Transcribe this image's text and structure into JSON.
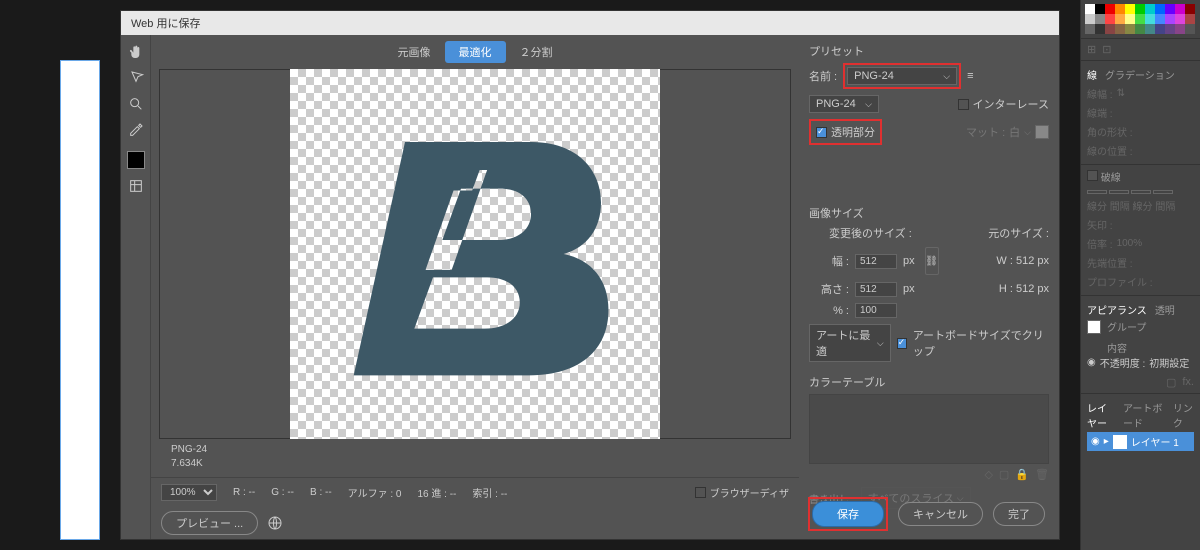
{
  "dialog": {
    "title": "Web 用に保存",
    "tabs": {
      "orig": "元画像",
      "optimized": "最適化",
      "split": "２分割"
    },
    "preview": {
      "format": "PNG-24",
      "size": "7.634K"
    },
    "bottom": {
      "zoom": "100%",
      "r": "R : --",
      "g": "G : --",
      "b": "B : --",
      "alpha": "アルファ : 0",
      "hex": "16 進 : --",
      "index": "索引 : --",
      "browser_dither": "ブラウザーディザ"
    },
    "preview_btn": "プレビュー ..."
  },
  "side": {
    "preset_label": "プリセット",
    "name_label": "名前 :",
    "preset_value": "PNG-24",
    "format_value": "PNG-24",
    "interlace": "インターレース",
    "transparency": "透明部分",
    "matte_label": "マット :",
    "matte_value": "白",
    "size_header": "画像サイズ",
    "after_size": "変更後のサイズ :",
    "orig_size": "元のサイズ :",
    "width_label": "幅 :",
    "width_val": "512",
    "px": "px",
    "height_label": "高さ :",
    "height_val": "512",
    "w_orig": "W :  512 px",
    "h_orig": "H :  512 px",
    "pct_label": "% :",
    "pct_val": "100",
    "fit": "アートに最適",
    "clip_artboard": "アートボードサイズでクリップ",
    "color_table": "カラーテーブル",
    "export_label": "書き出し :",
    "export_value": "すべてのスライス"
  },
  "actions": {
    "save": "保存",
    "cancel": "キャンセル",
    "done": "完了"
  },
  "right": {
    "stroke_tab": "線",
    "gradient_tab": "グラデーション",
    "stroke_width": "線幅 :",
    "dash": "破線",
    "appearance": "アピアランス",
    "transparency": "透明",
    "group": "グループ",
    "contents": "内容",
    "opacity_label": "不透明度 :",
    "opacity_val": "初期設定",
    "layers_tab": "レイヤー",
    "artboard_tab": "アートボード",
    "link_tab": "リンク",
    "layer_name": "レイヤー 1",
    "corner": "角の形状 :",
    "pos": "線の位置 :",
    "arrow": "矢印 :",
    "scale": "倍率 :",
    "scale_val": "100%",
    "tip": "先端位置 :",
    "profile": "プロファイル :"
  }
}
